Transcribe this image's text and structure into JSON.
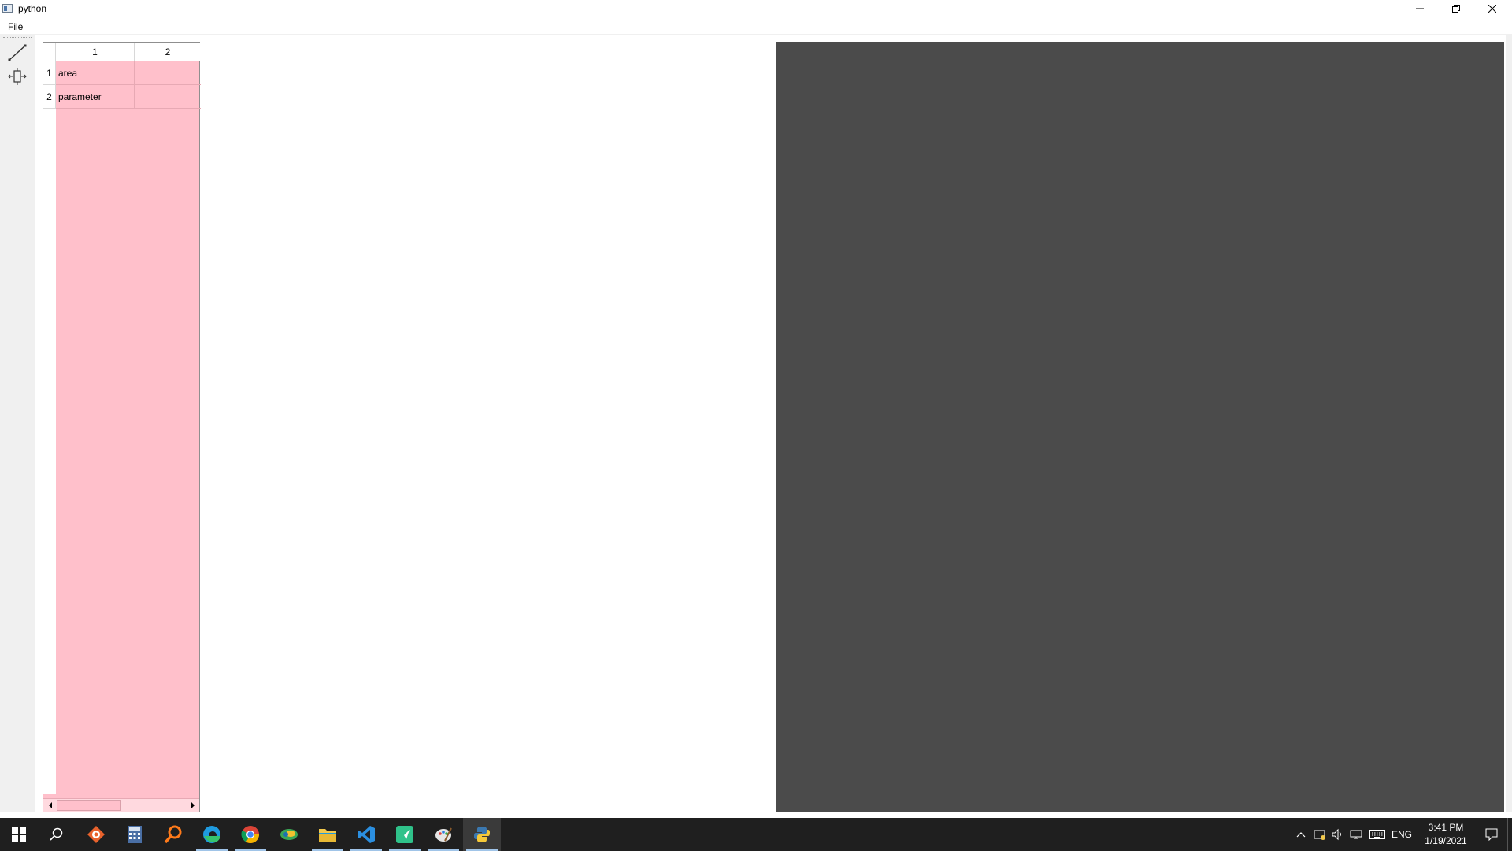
{
  "window": {
    "title": "python"
  },
  "menu": {
    "file_label": "File"
  },
  "toolbar": {
    "tools": [
      {
        "icon": "line-tool-icon"
      },
      {
        "icon": "move-tool-icon"
      }
    ]
  },
  "table": {
    "column_headers": [
      "1",
      "2"
    ],
    "row_headers": [
      "1",
      "2"
    ],
    "rows": [
      [
        "area",
        ""
      ],
      [
        "parameter",
        ""
      ]
    ],
    "background_color": "#ffc0cb"
  },
  "canvas": {
    "background_color": "#4b4b4b"
  },
  "taskbar": {
    "apps": [
      {
        "icon": "start-icon"
      },
      {
        "icon": "search-icon"
      },
      {
        "icon": "app-orange-icon"
      },
      {
        "icon": "calculator-icon"
      },
      {
        "icon": "magnifier-icon"
      },
      {
        "icon": "edge-icon"
      },
      {
        "icon": "chrome-icon"
      },
      {
        "icon": "app-green-icon"
      },
      {
        "icon": "file-explorer-icon"
      },
      {
        "icon": "vscode-icon"
      },
      {
        "icon": "app-teal-icon"
      },
      {
        "icon": "paint-icon"
      },
      {
        "icon": "python-icon"
      }
    ],
    "tray": {
      "language": "ENG",
      "time": "3:41 PM",
      "date": "1/19/2021"
    }
  }
}
